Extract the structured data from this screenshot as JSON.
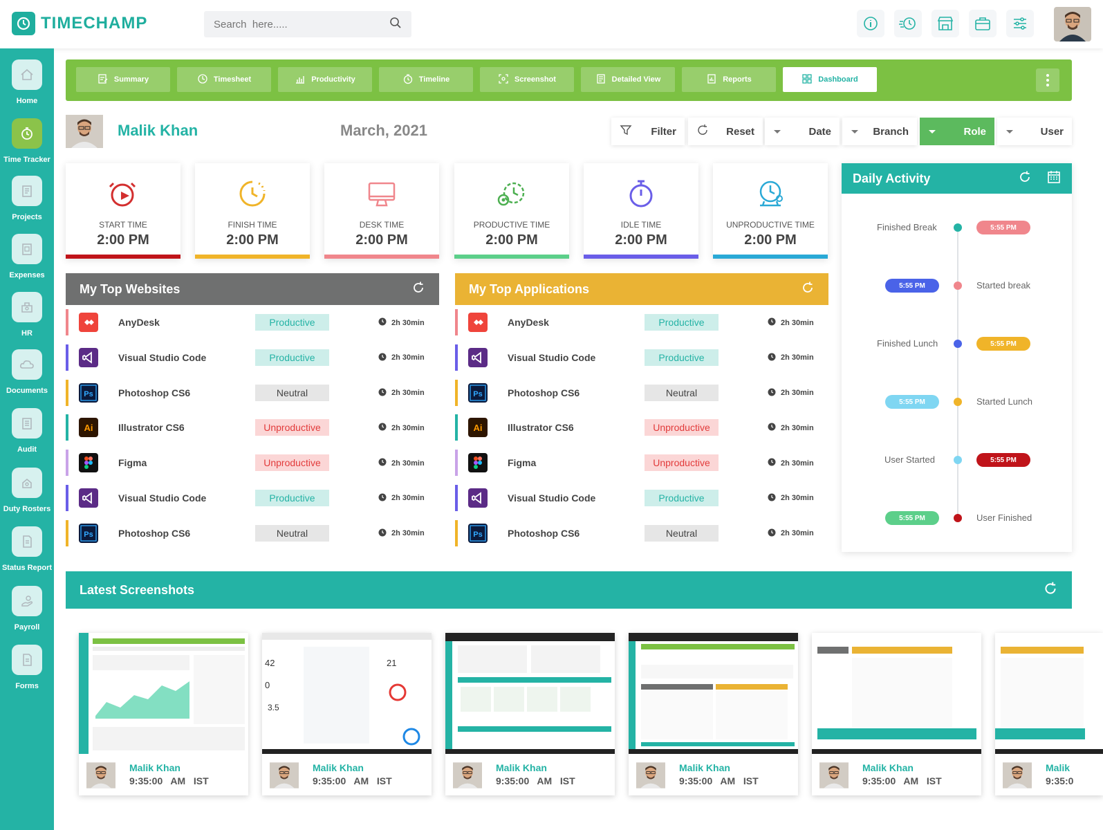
{
  "brand": {
    "name": "TIMECHAMP",
    "accent": "#24b3a5",
    "green": "#7cc143"
  },
  "search": {
    "placeholder": "Search  here....."
  },
  "topbar_icons": [
    "info-icon",
    "speed-timer-icon",
    "store-icon",
    "briefcase-icon",
    "sliders-icon"
  ],
  "sidebar": {
    "items": [
      {
        "label": "Home",
        "icon": "home-icon"
      },
      {
        "label": "Time Tracker",
        "icon": "timer-icon",
        "active": true
      },
      {
        "label": "Projects",
        "icon": "projects-icon"
      },
      {
        "label": "Expenses",
        "icon": "expenses-icon"
      },
      {
        "label": "HR",
        "icon": "hr-icon"
      },
      {
        "label": "Documents",
        "icon": "cloud-icon"
      },
      {
        "label": "Audit",
        "icon": "audit-icon"
      },
      {
        "label": "Duty Rosters",
        "icon": "roster-icon"
      },
      {
        "label": "Status Report",
        "icon": "report-icon"
      },
      {
        "label": "Payroll",
        "icon": "payroll-icon"
      },
      {
        "label": "Forms",
        "icon": "forms-icon"
      }
    ]
  },
  "nav": {
    "tabs": [
      {
        "label": "Summary",
        "icon": "summary-icon"
      },
      {
        "label": "Timesheet",
        "icon": "clock-icon"
      },
      {
        "label": "Productivity",
        "icon": "chart-icon"
      },
      {
        "label": "Timeline",
        "icon": "timeline-icon"
      },
      {
        "label": "Screenshot",
        "icon": "screenshot-icon"
      },
      {
        "label": "Detailed View",
        "icon": "detail-icon"
      },
      {
        "label": "Reports",
        "icon": "reports-icon"
      },
      {
        "label": "Dashboard",
        "icon": "dashboard-icon",
        "active": true
      }
    ]
  },
  "profile": {
    "name": "Malik Khan",
    "date": "March, 2021"
  },
  "filters": {
    "filter": "Filter",
    "reset": "Reset",
    "date": "Date",
    "branch": "Branch",
    "role": "Role",
    "user": "User"
  },
  "stats": [
    {
      "label": "START TIME",
      "value": "2:00 PM",
      "color": "#d32f2f",
      "icon": "alarm-play-icon"
    },
    {
      "label": "FINISH TIME",
      "value": "2:00 PM",
      "color": "#f0b429",
      "icon": "clock-finish-icon"
    },
    {
      "label": "DESK TIME",
      "value": "2:00 PM",
      "color": "#f0868c",
      "icon": "monitor-icon"
    },
    {
      "label": "PRODUCTIVE TIME",
      "value": "2:00 PM",
      "color": "#5ccf8a",
      "icon": "productive-gear-icon"
    },
    {
      "label": "IDLE TIME",
      "value": "2:00 PM",
      "color": "#6a5ee8",
      "icon": "stopwatch-icon"
    },
    {
      "label": "UNPRODUCTIVE TIME",
      "value": "2:00 PM",
      "color": "#2aa9d6",
      "icon": "unproductive-clock-icon"
    }
  ],
  "daily_activity": {
    "title": "Daily Activity",
    "events": [
      {
        "label": "Finished Break",
        "time": "5:55 PM",
        "side": "left-label",
        "dot": "#24b3a5",
        "pill": "#f0868c"
      },
      {
        "label": "Started break",
        "time": "5:55 PM",
        "side": "right-label",
        "dot": "#f0868c",
        "pill": "#4a63e8"
      },
      {
        "label": "Finished Lunch",
        "time": "5:55 PM",
        "side": "left-label",
        "dot": "#4a63e8",
        "pill": "#f0b429"
      },
      {
        "label": "Started Lunch",
        "time": "5:55 PM",
        "side": "right-label",
        "dot": "#f0b429",
        "pill": "#7fd6f2"
      },
      {
        "label": "User Started",
        "time": "5:55 PM",
        "side": "left-label",
        "dot": "#7fd6f2",
        "pill": "#c0141a"
      },
      {
        "label": "User Finished",
        "time": "5:55 PM",
        "side": "right-label",
        "dot": "#c0141a",
        "pill": "#5ccf8a"
      }
    ]
  },
  "top_websites": {
    "title": "My Top Websites",
    "header_color": "#6f7070",
    "rows": [
      {
        "name": "AnyDesk",
        "status": "Productive",
        "time": "2h 30min",
        "bar": "#f0868c",
        "icon": "anydesk-icon"
      },
      {
        "name": "Visual Studio Code",
        "status": "Productive",
        "time": "2h 30min",
        "bar": "#6a5ee8",
        "icon": "vscode-icon"
      },
      {
        "name": "Photoshop CS6",
        "status": "Neutral",
        "time": "2h 30min",
        "bar": "#f0b429",
        "icon": "photoshop-icon"
      },
      {
        "name": "Illustrator CS6",
        "status": "Unproductive",
        "time": "2h 30min",
        "bar": "#24b3a5",
        "icon": "illustrator-icon"
      },
      {
        "name": "Figma",
        "status": "Unproductive",
        "time": "2h 30min",
        "bar": "#c9a3e8",
        "icon": "figma-icon"
      },
      {
        "name": "Visual Studio Code",
        "status": "Productive",
        "time": "2h 30min",
        "bar": "#6a5ee8",
        "icon": "vscode-icon"
      },
      {
        "name": "Photoshop CS6",
        "status": "Neutral",
        "time": "2h 30min",
        "bar": "#f0b429",
        "icon": "photoshop-icon"
      }
    ]
  },
  "top_applications": {
    "title": "My Top Applications",
    "header_color": "#eab334",
    "rows": [
      {
        "name": "AnyDesk",
        "status": "Productive",
        "time": "2h 30min",
        "bar": "#f0868c",
        "icon": "anydesk-icon"
      },
      {
        "name": "Visual Studio Code",
        "status": "Productive",
        "time": "2h 30min",
        "bar": "#6a5ee8",
        "icon": "vscode-icon"
      },
      {
        "name": "Photoshop CS6",
        "status": "Neutral",
        "time": "2h 30min",
        "bar": "#f0b429",
        "icon": "photoshop-icon"
      },
      {
        "name": "Illustrator CS6",
        "status": "Unproductive",
        "time": "2h 30min",
        "bar": "#24b3a5",
        "icon": "illustrator-icon"
      },
      {
        "name": "Figma",
        "status": "Unproductive",
        "time": "2h 30min",
        "bar": "#c9a3e8",
        "icon": "figma-icon"
      },
      {
        "name": "Visual Studio Code",
        "status": "Productive",
        "time": "2h 30min",
        "bar": "#6a5ee8",
        "icon": "vscode-icon"
      },
      {
        "name": "Photoshop CS6",
        "status": "Neutral",
        "time": "2h 30min",
        "bar": "#f0b429",
        "icon": "photoshop-icon"
      }
    ]
  },
  "screenshots": {
    "title": "Latest Screenshots",
    "items": [
      {
        "name": "Malik Khan",
        "time": "9:35:00   AM   IST"
      },
      {
        "name": "Malik Khan",
        "time": "9:35:00   AM   IST"
      },
      {
        "name": "Malik Khan",
        "time": "9:35:00   AM   IST"
      },
      {
        "name": "Malik Khan",
        "time": "9:35:00   AM   IST"
      },
      {
        "name": "Malik Khan",
        "time": "9:35:00   AM   IST"
      },
      {
        "name": "Malik",
        "time": "9:35:0"
      }
    ]
  }
}
